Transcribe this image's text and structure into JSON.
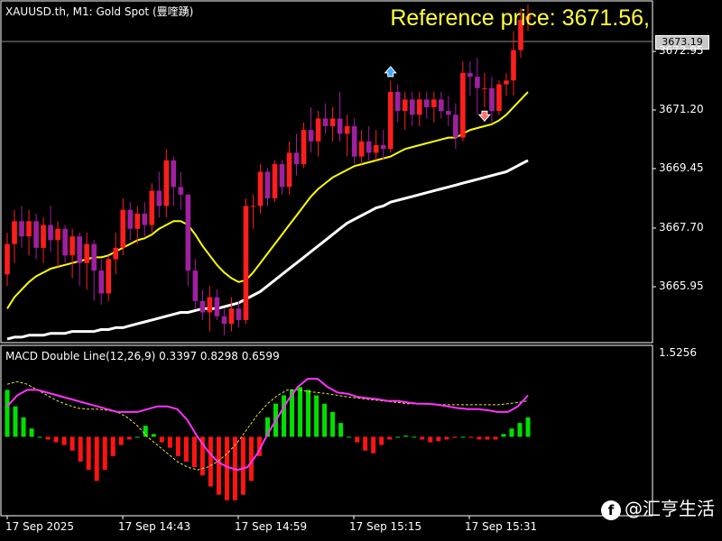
{
  "header": {
    "symbol_title": "XAUUSD.th, M1:  Gold Spot (豐喹踴)",
    "reference_price": "Reference price: 3671.56,"
  },
  "price_panel": {
    "current_price_tag": "3673.19",
    "price_ticks": [
      "3672.95",
      "3671.20",
      "3669.45",
      "3667.70",
      "3665.95"
    ]
  },
  "macd_panel": {
    "label": "MACD Double Line(12,26,9) 0.3397 0.8298 0.6599",
    "top_tick": "1.5256"
  },
  "time_axis": {
    "ticks": [
      "17 Sep 2025",
      "17 Sep 14:43",
      "17 Sep 14:59",
      "17 Sep 15:15",
      "17 Sep 15:31"
    ]
  },
  "watermark": {
    "icon": "f",
    "text": "@汇亨生活"
  },
  "colors": {
    "up_candle": "#ff1e1e",
    "down_candle": "#a020a0",
    "yellow_ma": "#ffff00",
    "white_ma": "#ffffff",
    "macd_main": "#ff33ff",
    "macd_main_alt": "#3fa9ff",
    "signal": "#e6e63c",
    "hist_pos": "#00e000",
    "hist_neg": "#ff1414"
  },
  "chart_data": {
    "type": "candlestick",
    "ylim": [
      3664.8,
      3673.6
    ],
    "candles": [
      {
        "x": 1,
        "o": 3666.5,
        "h": 3667.6,
        "l": 3666.2,
        "c": 3667.3
      },
      {
        "x": 2,
        "o": 3667.3,
        "h": 3668.2,
        "l": 3666.8,
        "c": 3667.9
      },
      {
        "x": 3,
        "o": 3667.9,
        "h": 3668.3,
        "l": 3667.2,
        "c": 3667.5
      },
      {
        "x": 4,
        "o": 3667.5,
        "h": 3668.2,
        "l": 3667.0,
        "c": 3667.9
      },
      {
        "x": 5,
        "o": 3667.9,
        "h": 3668.1,
        "l": 3666.9,
        "c": 3667.2
      },
      {
        "x": 6,
        "o": 3667.2,
        "h": 3668.0,
        "l": 3666.8,
        "c": 3667.8
      },
      {
        "x": 7,
        "o": 3667.8,
        "h": 3668.3,
        "l": 3667.1,
        "c": 3667.4
      },
      {
        "x": 8,
        "o": 3667.4,
        "h": 3667.9,
        "l": 3666.7,
        "c": 3667.7
      },
      {
        "x": 9,
        "o": 3667.7,
        "h": 3667.8,
        "l": 3666.8,
        "c": 3667.0
      },
      {
        "x": 10,
        "o": 3667.0,
        "h": 3667.7,
        "l": 3666.4,
        "c": 3667.5
      },
      {
        "x": 11,
        "o": 3667.5,
        "h": 3667.6,
        "l": 3666.2,
        "c": 3666.8
      },
      {
        "x": 12,
        "o": 3666.8,
        "h": 3667.6,
        "l": 3666.1,
        "c": 3667.3
      },
      {
        "x": 13,
        "o": 3667.3,
        "h": 3667.4,
        "l": 3665.8,
        "c": 3666.6
      },
      {
        "x": 14,
        "o": 3666.6,
        "h": 3666.9,
        "l": 3665.7,
        "c": 3666.0
      },
      {
        "x": 15,
        "o": 3666.0,
        "h": 3667.0,
        "l": 3665.8,
        "c": 3666.9
      },
      {
        "x": 16,
        "o": 3666.9,
        "h": 3667.6,
        "l": 3666.5,
        "c": 3667.2
      },
      {
        "x": 17,
        "o": 3667.2,
        "h": 3668.5,
        "l": 3667.0,
        "c": 3668.2
      },
      {
        "x": 18,
        "o": 3668.2,
        "h": 3668.4,
        "l": 3667.4,
        "c": 3667.7
      },
      {
        "x": 19,
        "o": 3667.7,
        "h": 3668.3,
        "l": 3667.3,
        "c": 3668.1
      },
      {
        "x": 20,
        "o": 3668.1,
        "h": 3668.4,
        "l": 3667.5,
        "c": 3667.8
      },
      {
        "x": 21,
        "o": 3667.8,
        "h": 3668.9,
        "l": 3667.6,
        "c": 3668.7
      },
      {
        "x": 22,
        "o": 3668.7,
        "h": 3669.2,
        "l": 3668.0,
        "c": 3668.3
      },
      {
        "x": 23,
        "o": 3668.3,
        "h": 3669.8,
        "l": 3668.0,
        "c": 3669.5
      },
      {
        "x": 24,
        "o": 3669.5,
        "h": 3669.6,
        "l": 3668.3,
        "c": 3668.8
      },
      {
        "x": 25,
        "o": 3668.8,
        "h": 3669.2,
        "l": 3668.2,
        "c": 3668.6
      },
      {
        "x": 26,
        "o": 3668.6,
        "h": 3668.6,
        "l": 3666.2,
        "c": 3666.6
      },
      {
        "x": 27,
        "o": 3666.6,
        "h": 3666.9,
        "l": 3665.6,
        "c": 3665.8
      },
      {
        "x": 28,
        "o": 3665.8,
        "h": 3666.1,
        "l": 3665.3,
        "c": 3665.5
      },
      {
        "x": 29,
        "o": 3665.5,
        "h": 3666.2,
        "l": 3665.0,
        "c": 3665.9
      },
      {
        "x": 30,
        "o": 3665.9,
        "h": 3666.1,
        "l": 3665.3,
        "c": 3665.4
      },
      {
        "x": 31,
        "o": 3665.4,
        "h": 3665.6,
        "l": 3664.9,
        "c": 3665.2
      },
      {
        "x": 32,
        "o": 3665.2,
        "h": 3665.9,
        "l": 3665.0,
        "c": 3665.6
      },
      {
        "x": 33,
        "o": 3665.6,
        "h": 3665.8,
        "l": 3665.1,
        "c": 3665.3
      },
      {
        "x": 34,
        "o": 3665.3,
        "h": 3668.5,
        "l": 3665.2,
        "c": 3668.3
      },
      {
        "x": 35,
        "o": 3668.3,
        "h": 3668.6,
        "l": 3667.7,
        "c": 3668.3
      },
      {
        "x": 36,
        "o": 3668.3,
        "h": 3669.4,
        "l": 3668.1,
        "c": 3669.2
      },
      {
        "x": 37,
        "o": 3669.2,
        "h": 3669.3,
        "l": 3668.3,
        "c": 3668.5
      },
      {
        "x": 38,
        "o": 3668.5,
        "h": 3669.5,
        "l": 3668.4,
        "c": 3669.4
      },
      {
        "x": 39,
        "o": 3669.4,
        "h": 3669.5,
        "l": 3668.6,
        "c": 3668.8
      },
      {
        "x": 40,
        "o": 3668.8,
        "h": 3670.0,
        "l": 3668.6,
        "c": 3669.7
      },
      {
        "x": 41,
        "o": 3669.7,
        "h": 3670.2,
        "l": 3669.1,
        "c": 3669.4
      },
      {
        "x": 42,
        "o": 3669.4,
        "h": 3670.5,
        "l": 3669.3,
        "c": 3670.3
      },
      {
        "x": 43,
        "o": 3670.3,
        "h": 3670.9,
        "l": 3669.7,
        "c": 3670.0
      },
      {
        "x": 44,
        "o": 3670.0,
        "h": 3670.8,
        "l": 3669.6,
        "c": 3670.6
      },
      {
        "x": 45,
        "o": 3670.6,
        "h": 3671.0,
        "l": 3670.2,
        "c": 3670.4
      },
      {
        "x": 46,
        "o": 3670.4,
        "h": 3670.9,
        "l": 3670.0,
        "c": 3670.6
      },
      {
        "x": 47,
        "o": 3670.6,
        "h": 3671.3,
        "l": 3670.0,
        "c": 3670.2
      },
      {
        "x": 48,
        "o": 3670.2,
        "h": 3670.7,
        "l": 3669.6,
        "c": 3670.4
      },
      {
        "x": 49,
        "o": 3670.4,
        "h": 3670.6,
        "l": 3669.4,
        "c": 3669.6
      },
      {
        "x": 50,
        "o": 3669.6,
        "h": 3670.3,
        "l": 3669.4,
        "c": 3670.0
      },
      {
        "x": 51,
        "o": 3670.0,
        "h": 3670.4,
        "l": 3669.5,
        "c": 3669.7
      },
      {
        "x": 52,
        "o": 3669.7,
        "h": 3670.3,
        "l": 3669.5,
        "c": 3669.9
      },
      {
        "x": 53,
        "o": 3669.9,
        "h": 3670.3,
        "l": 3669.5,
        "c": 3669.8
      },
      {
        "x": 54,
        "o": 3669.8,
        "h": 3671.6,
        "l": 3669.7,
        "c": 3671.3
      },
      {
        "x": 55,
        "o": 3671.3,
        "h": 3671.5,
        "l": 3670.5,
        "c": 3670.8
      },
      {
        "x": 56,
        "o": 3670.8,
        "h": 3671.3,
        "l": 3670.3,
        "c": 3671.1
      },
      {
        "x": 57,
        "o": 3671.1,
        "h": 3671.3,
        "l": 3670.4,
        "c": 3670.7
      },
      {
        "x": 58,
        "o": 3670.7,
        "h": 3671.3,
        "l": 3670.4,
        "c": 3671.1
      },
      {
        "x": 59,
        "o": 3671.1,
        "h": 3671.3,
        "l": 3670.6,
        "c": 3670.9
      },
      {
        "x": 60,
        "o": 3670.9,
        "h": 3671.3,
        "l": 3670.5,
        "c": 3671.1
      },
      {
        "x": 61,
        "o": 3671.1,
        "h": 3671.3,
        "l": 3670.6,
        "c": 3670.8
      },
      {
        "x": 62,
        "o": 3670.8,
        "h": 3671.2,
        "l": 3670.4,
        "c": 3670.7
      },
      {
        "x": 63,
        "o": 3670.7,
        "h": 3671.0,
        "l": 3669.8,
        "c": 3670.1
      },
      {
        "x": 64,
        "o": 3670.1,
        "h": 3672.1,
        "l": 3670.0,
        "c": 3671.8
      },
      {
        "x": 65,
        "o": 3671.8,
        "h": 3672.1,
        "l": 3671.2,
        "c": 3671.7
      },
      {
        "x": 66,
        "o": 3671.7,
        "h": 3672.2,
        "l": 3670.7,
        "c": 3671.4
      },
      {
        "x": 67,
        "o": 3671.4,
        "h": 3671.8,
        "l": 3670.9,
        "c": 3671.4
      },
      {
        "x": 68,
        "o": 3671.4,
        "h": 3671.7,
        "l": 3670.5,
        "c": 3670.8
      },
      {
        "x": 69,
        "o": 3670.8,
        "h": 3671.6,
        "l": 3670.7,
        "c": 3671.5
      },
      {
        "x": 70,
        "o": 3671.5,
        "h": 3671.8,
        "l": 3671.2,
        "c": 3671.6
      },
      {
        "x": 71,
        "o": 3671.6,
        "h": 3672.9,
        "l": 3671.2,
        "c": 3672.4
      },
      {
        "x": 72,
        "o": 3672.4,
        "h": 3673.5,
        "l": 3672.2,
        "c": 3673.2
      },
      {
        "x": 73,
        "o": 3673.2,
        "h": 3673.6,
        "l": 3672.9,
        "c": 3673.3
      }
    ],
    "ma_yellow": [
      3665.6,
      3665.9,
      3666.1,
      3666.3,
      3666.45,
      3666.55,
      3666.65,
      3666.7,
      3666.75,
      3666.8,
      3666.85,
      3666.9,
      3666.95,
      3666.95,
      3667.0,
      3667.1,
      3667.2,
      3667.3,
      3667.4,
      3667.45,
      3667.55,
      3667.7,
      3667.8,
      3667.9,
      3667.9,
      3667.8,
      3667.55,
      3667.25,
      3667.0,
      3666.75,
      3666.55,
      3666.4,
      3666.3,
      3666.35,
      3666.55,
      3666.8,
      3667.05,
      3667.3,
      3667.55,
      3667.8,
      3668.05,
      3668.3,
      3668.55,
      3668.75,
      3668.9,
      3669.05,
      3669.15,
      3669.25,
      3669.35,
      3669.4,
      3669.45,
      3669.5,
      3669.55,
      3669.6,
      3669.7,
      3669.8,
      3669.85,
      3669.9,
      3669.95,
      3670.0,
      3670.05,
      3670.1,
      3670.1,
      3670.2,
      3670.3,
      3670.35,
      3670.4,
      3670.45,
      3670.55,
      3670.7,
      3670.9,
      3671.1,
      3671.3
    ],
    "ma_white": [
      3664.8,
      3664.85,
      3664.85,
      3664.9,
      3664.9,
      3664.9,
      3664.95,
      3664.95,
      3664.95,
      3665.0,
      3665.0,
      3665.0,
      3665.0,
      3665.05,
      3665.05,
      3665.1,
      3665.1,
      3665.15,
      3665.2,
      3665.25,
      3665.3,
      3665.35,
      3665.4,
      3665.45,
      3665.5,
      3665.5,
      3665.55,
      3665.6,
      3665.6,
      3665.6,
      3665.65,
      3665.7,
      3665.75,
      3665.85,
      3665.95,
      3666.05,
      3666.2,
      3666.35,
      3666.5,
      3666.65,
      3666.8,
      3666.95,
      3667.1,
      3667.25,
      3667.4,
      3667.55,
      3667.7,
      3667.85,
      3667.95,
      3668.05,
      3668.15,
      3668.25,
      3668.3,
      3668.4,
      3668.45,
      3668.5,
      3668.55,
      3668.6,
      3668.65,
      3668.7,
      3668.75,
      3668.8,
      3668.85,
      3668.9,
      3668.95,
      3669.0,
      3669.05,
      3669.1,
      3669.15,
      3669.2,
      3669.3,
      3669.4,
      3669.5
    ],
    "arrows": [
      {
        "x": 54,
        "price": 3671.8,
        "dir": "up"
      },
      {
        "x": 67,
        "price": 3670.7,
        "dir": "down"
      }
    ],
    "macd": {
      "ylim": [
        -1.3,
        1.5256
      ],
      "hist": [
        0.85,
        0.55,
        0.35,
        0.15,
        0.0,
        -0.05,
        -0.1,
        -0.15,
        -0.25,
        -0.45,
        -0.6,
        -0.8,
        -0.6,
        -0.35,
        -0.15,
        -0.05,
        0.0,
        0.2,
        0.05,
        -0.1,
        -0.2,
        -0.35,
        -0.45,
        -0.55,
        -0.7,
        -0.9,
        -1.05,
        -1.15,
        -1.15,
        -1.05,
        -0.8,
        -0.35,
        0.35,
        0.6,
        0.75,
        0.85,
        0.9,
        0.85,
        0.75,
        0.6,
        0.45,
        0.25,
        0.0,
        -0.1,
        -0.25,
        -0.3,
        -0.15,
        -0.05,
        0.0,
        0.02,
        0.0,
        -0.05,
        -0.1,
        -0.08,
        -0.05,
        -0.02,
        0.0,
        -0.02,
        -0.05,
        -0.05,
        -0.05,
        0.05,
        0.15,
        0.25,
        0.35
      ],
      "main": [
        0.55,
        0.75,
        0.85,
        0.85,
        0.8,
        0.75,
        0.7,
        0.65,
        0.6,
        0.55,
        0.5,
        0.45,
        0.45,
        0.45,
        0.5,
        0.55,
        0.55,
        0.5,
        0.3,
        0.0,
        -0.25,
        -0.45,
        -0.55,
        -0.6,
        -0.55,
        -0.3,
        0.05,
        0.35,
        0.65,
        0.9,
        1.05,
        1.05,
        0.9,
        0.8,
        0.78,
        0.72,
        0.7,
        0.68,
        0.65,
        0.65,
        0.62,
        0.6,
        0.6,
        0.58,
        0.55,
        0.52,
        0.5,
        0.5,
        0.48,
        0.45,
        0.45,
        0.55,
        0.75
      ],
      "signal": [
        0.95,
        1.0,
        0.95,
        0.85,
        0.75,
        0.65,
        0.58,
        0.52,
        0.5,
        0.5,
        0.48,
        0.45,
        0.35,
        0.2,
        0.0,
        -0.15,
        -0.3,
        -0.45,
        -0.55,
        -0.6,
        -0.55,
        -0.45,
        -0.3,
        -0.1,
        0.15,
        0.4,
        0.6,
        0.75,
        0.85,
        0.85,
        0.82,
        0.8,
        0.78,
        0.75,
        0.72,
        0.7,
        0.68,
        0.66,
        0.64,
        0.62,
        0.6,
        0.6,
        0.59,
        0.58,
        0.58,
        0.58,
        0.58,
        0.58,
        0.58,
        0.58,
        0.6,
        0.62,
        0.65
      ]
    }
  }
}
